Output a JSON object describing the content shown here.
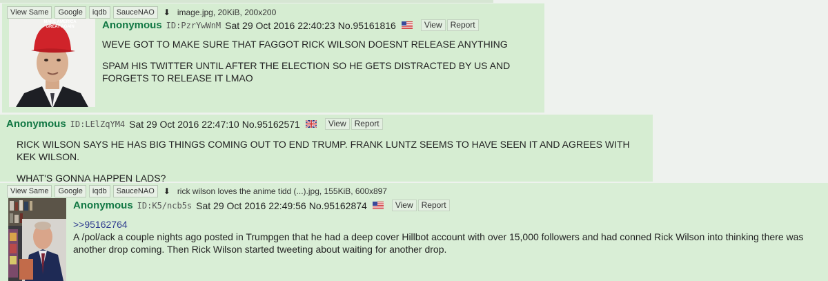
{
  "posts": [
    {
      "toolbar": [
        "View Same",
        "Google",
        "iqdb",
        "SauceNAO"
      ],
      "download_icon": "download-icon",
      "file_info": "image.jpg, 20KiB, 200x200",
      "hat_text": "MAKE AMERICA GREAT AGAIN",
      "name": "Anonymous",
      "id": "ID:PzrYwWnM",
      "datetime": "Sat 29 Oct 2016 22:40:23",
      "number": "No.95161816",
      "flag": "us-flag-icon",
      "view_label": "View",
      "report_label": "Report",
      "lines": [
        "WEVE GOT TO MAKE SURE THAT FAGGOT RICK WILSON DOESNT RELEASE ANYTHING",
        "SPAM HIS TWITTER UNTIL AFTER THE ELECTION SO HE GETS DISTRACTED BY US AND FORGETS TO RELEASE IT LMAO"
      ]
    },
    {
      "name": "Anonymous",
      "id": "ID:LElZqYM4",
      "datetime": "Sat 29 Oct 2016 22:47:10",
      "number": "No.95162571",
      "flag": "uk-flag-icon",
      "view_label": "View",
      "report_label": "Report",
      "lines": [
        "RICK WILSON SAYS HE HAS BIG THINGS COMING OUT TO END TRUMP. FRANK LUNTZ SEEMS TO HAVE SEEN IT AND AGREES WITH KEK WILSON.",
        "WHAT'S GONNA HAPPEN LADS?"
      ]
    },
    {
      "toolbar": [
        "View Same",
        "Google",
        "iqdb",
        "SauceNAO"
      ],
      "download_icon": "download-icon",
      "file_info": "rick wilson loves the anime tidd (...).jpg, 155KiB, 600x897",
      "name": "Anonymous",
      "id": "ID:K5/ncb5s",
      "datetime": "Sat 29 Oct 2016 22:49:56",
      "number": "No.95162874",
      "flag": "us-flag-icon",
      "view_label": "View",
      "report_label": "Report",
      "quote": ">>95162764",
      "lines": [
        "A /pol/ack a couple nights ago posted in Trumpgen that he had a deep cover Hillbot account with over 15,000 followers and had conned Rick Wilson into thinking there was another drop coming. Then Rick Wilson started tweeting about waiting for another drop."
      ]
    }
  ]
}
